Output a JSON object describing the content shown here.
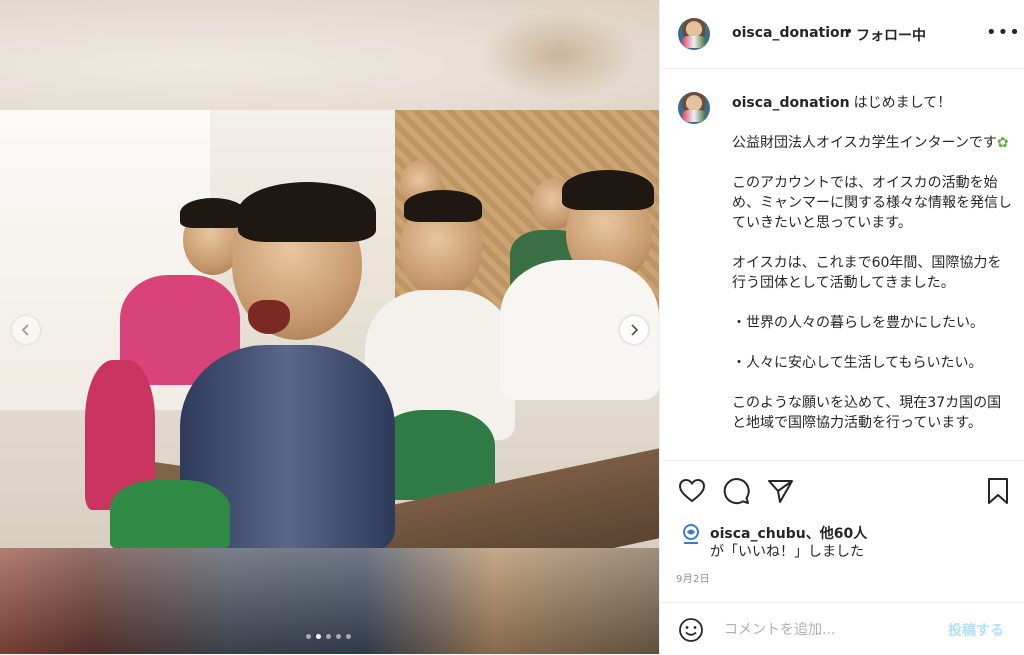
{
  "post": {
    "username": "oisca_donation",
    "separator": "•",
    "follow_status": "フォロー中",
    "more_icon": "more-horizontal-icon"
  },
  "caption": {
    "username": "oisca_donation",
    "lines": [
      "はじめまして！",
      "公益財団法人オイスカ学生インターンです",
      "このアカウントでは、オイスカの活動を始め、ミャンマーに関する様々な情報を発信していきたいと思っています。",
      "オイスカは、これまで60年間、国際協力を行う団体として活動してきました。",
      "・世界の人々の暮らしを豊かにしたい。",
      "・人々に安心して生活してもらいたい。",
      "このような願いを込めて、現在37カ国の国と地域で国際協力活動を行っています。"
    ]
  },
  "actions": {
    "icons": [
      "heart-icon",
      "comment-icon",
      "share-icon",
      "bookmark-icon"
    ]
  },
  "likes": {
    "liker": "oisca_chubu",
    "others": "、他60人",
    "suffix": "が「いいね！」しました"
  },
  "date": "9月2日",
  "comment": {
    "placeholder": "コメントを追加...",
    "post_label": "投稿する"
  },
  "carousel": {
    "total_images": 5,
    "current_index": 2
  },
  "colors": {
    "text": "#262626",
    "muted": "#8e8e8e",
    "post_button_disabled": "#b2dffc",
    "border": "#efefef"
  }
}
